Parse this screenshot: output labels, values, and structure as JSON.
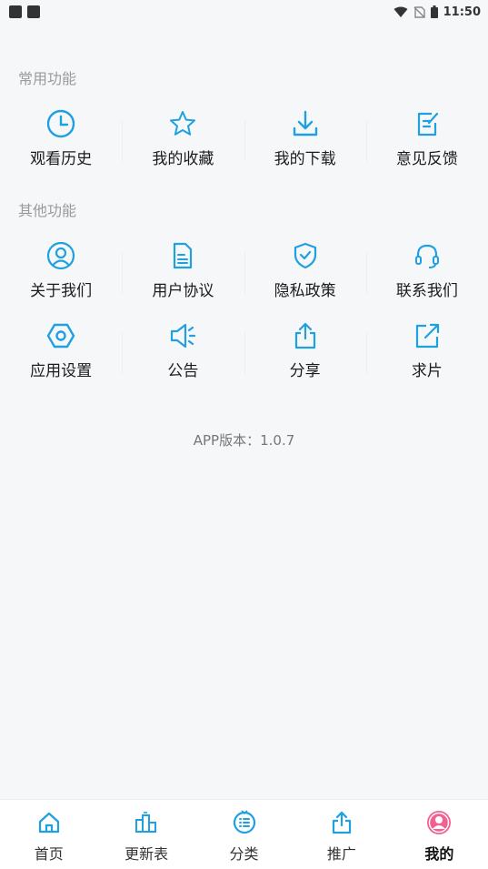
{
  "status": {
    "time": "11:50"
  },
  "sections": {
    "common": {
      "title": "常用功能",
      "items": [
        {
          "label": "观看历史",
          "icon": "clock-icon"
        },
        {
          "label": "我的收藏",
          "icon": "star-icon"
        },
        {
          "label": "我的下载",
          "icon": "download-icon"
        },
        {
          "label": "意见反馈",
          "icon": "feedback-icon"
        }
      ]
    },
    "other": {
      "title": "其他功能",
      "items": [
        {
          "label": "关于我们",
          "icon": "user-circle-icon"
        },
        {
          "label": "用户协议",
          "icon": "document-icon"
        },
        {
          "label": "隐私政策",
          "icon": "shield-check-icon"
        },
        {
          "label": "联系我们",
          "icon": "headset-icon"
        },
        {
          "label": "应用设置",
          "icon": "hexagon-settings-icon"
        },
        {
          "label": "公告",
          "icon": "megaphone-icon"
        },
        {
          "label": "分享",
          "icon": "share-icon"
        },
        {
          "label": "求片",
          "icon": "external-link-icon"
        }
      ]
    }
  },
  "version": "APP版本：1.0.7",
  "bottom_nav": [
    {
      "label": "首页",
      "icon": "home-icon"
    },
    {
      "label": "更新表",
      "icon": "schedule-icon"
    },
    {
      "label": "分类",
      "icon": "category-icon"
    },
    {
      "label": "推广",
      "icon": "promote-share-icon"
    },
    {
      "label": "我的",
      "icon": "profile-icon",
      "active": true
    }
  ],
  "colors": {
    "accent": "#1fa0e0",
    "active": "#f06292",
    "background": "#f6f7f9"
  }
}
